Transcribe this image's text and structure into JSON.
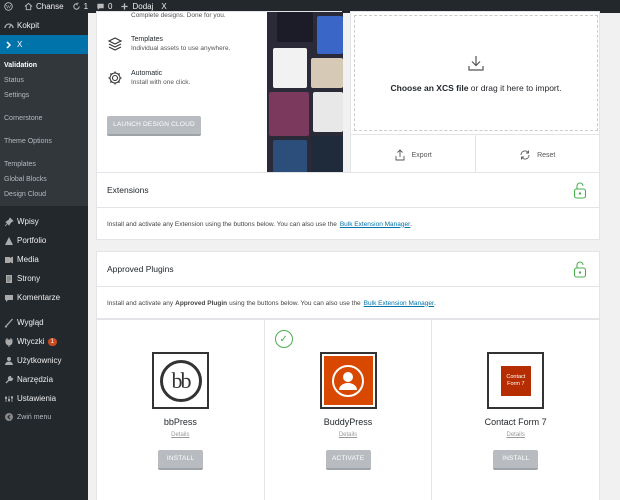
{
  "adminbar": {
    "site_name": "Chanse",
    "updates_count": "1",
    "comments_count": "0",
    "new_label": "Dodaj",
    "x_label": "X"
  },
  "sidebar": {
    "top_items": [
      {
        "label": "Kokpit",
        "icon": "dashboard-icon"
      },
      {
        "label": "X",
        "icon": "x-icon"
      }
    ],
    "submenu": [
      "Validation",
      "Status",
      "Settings",
      "Cornerstone",
      "Theme Options",
      "Templates",
      "Global Blocks",
      "Design Cloud"
    ],
    "items": [
      {
        "label": "Wpisy",
        "icon": "pin-icon"
      },
      {
        "label": "Portfolio",
        "icon": "portfolio-icon"
      },
      {
        "label": "Media",
        "icon": "media-icon"
      },
      {
        "label": "Strony",
        "icon": "pages-icon"
      },
      {
        "label": "Komentarze",
        "icon": "comments-icon"
      },
      {
        "label": "Wygląd",
        "icon": "appearance-icon"
      },
      {
        "label": "Wtyczki",
        "icon": "plugins-icon",
        "badge": "1"
      },
      {
        "label": "Użytkownicy",
        "icon": "users-icon"
      },
      {
        "label": "Narzędzia",
        "icon": "tools-icon"
      },
      {
        "label": "Ustawienia",
        "icon": "settings-icon"
      }
    ],
    "collapse_label": "Zwiń menu"
  },
  "design_cloud": {
    "partial_desc": "Complete designs. Done for you.",
    "features": [
      {
        "title": "Templates",
        "desc": "Individual assets to use anywhere."
      },
      {
        "title": "Automatic",
        "desc": "Install with one click."
      }
    ],
    "launch_label": "LAUNCH DESIGN CLOUD"
  },
  "import": {
    "prompt_bold": "Choose an XCS file",
    "prompt_rest": " or drag it here to import.",
    "export_label": "Export",
    "reset_label": "Reset"
  },
  "extensions": {
    "title": "Extensions",
    "desc_before": "Install and activate any Extension using the buttons below. You can also use the",
    "link": "Bulk Extension Manager",
    "desc_after": "."
  },
  "approved": {
    "title": "Approved Plugins",
    "desc_before": "Install and activate any",
    "desc_bold": "Approved Plugin",
    "desc_mid": "using the buttons below. You can also use the",
    "link": "Bulk Extension Manager",
    "desc_after": "."
  },
  "plugins": [
    {
      "name": "bbPress",
      "details": "Details",
      "button": "INSTALL",
      "logo_text": "bb",
      "installed": false
    },
    {
      "name": "BuddyPress",
      "details": "Details",
      "button": "ACTIVATE",
      "logo_text": "",
      "installed": true
    },
    {
      "name": "Contact Form 7",
      "details": "Details",
      "button": "INSTALL",
      "logo_text": "Contact Form 7",
      "installed": false
    }
  ],
  "colors": {
    "admin_dark": "#23282d",
    "admin_blue": "#0073aa",
    "lock_green": "#4caf50",
    "buddypress_orange": "#d84800",
    "cf7_red": "#b52d00"
  }
}
